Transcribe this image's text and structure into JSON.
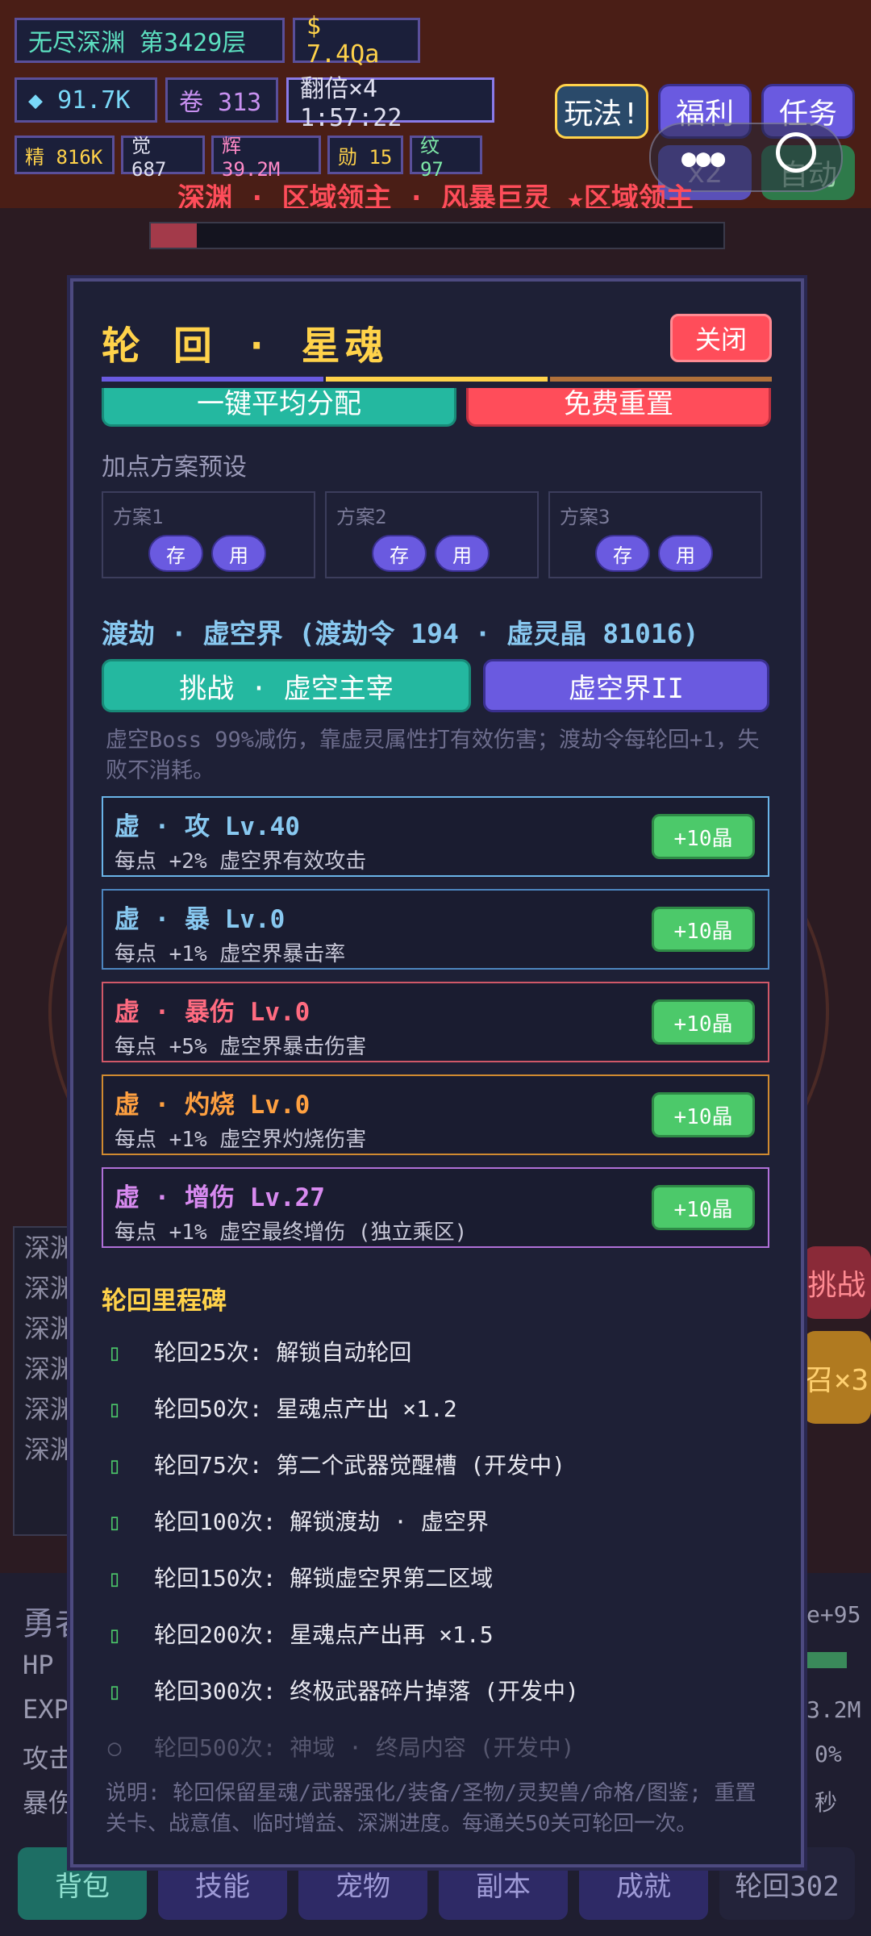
{
  "hud": {
    "realm": "无尽深渊 第3429层",
    "gold": "$ 7.4Qa",
    "diamond": "◆ 91.7K",
    "scroll": "卷 313",
    "multiplier": "翻倍×4 1:57:22",
    "stats": [
      "精 816K",
      "觉 687",
      "辉 39.2M",
      "勋 15",
      "纹 97"
    ],
    "buttons": {
      "play": "玩法!",
      "welfare": "福利",
      "tasks": "任务",
      "speed": "x2",
      "auto": "自动"
    },
    "boss_line": "深渊 · 区域领主 · 风暴巨灵 ★区域领主"
  },
  "behind": {
    "side_items": [
      "深渊",
      "深渊",
      "深渊",
      "深渊",
      "深渊",
      "深渊"
    ],
    "right_btn1": "挑战",
    "right_btn2": "召×3",
    "hero": "勇者",
    "hp": "HP",
    "exp": "EXP",
    "atk": "攻击",
    "crit": "暴伤",
    "right_val1": "e+95",
    "right_val2": "3.2M",
    "right_val3": "0%",
    "right_val4": "秒"
  },
  "tabs": [
    "背包",
    "技能",
    "宠物",
    "副本",
    "成就",
    "轮回302"
  ],
  "modal": {
    "title": "轮 回 · 星魂",
    "close": "关闭",
    "avg_btn": "一键平均分配",
    "reset_btn": "免费重置",
    "preset_label": "加点方案预设",
    "presets": [
      {
        "name": "方案1",
        "save": "存",
        "use": "用"
      },
      {
        "name": "方案2",
        "save": "存",
        "use": "用"
      },
      {
        "name": "方案3",
        "save": "存",
        "use": "用"
      }
    ],
    "void_title": "渡劫 · 虚空界 (渡劫令 194 · 虚灵晶 81016)",
    "challenge_btn": "挑战 · 虚空主宰",
    "realm_btn": "虚空界II",
    "void_desc": "虚空Boss 99%减伤，靠虚灵属性打有效伤害；渡劫令每轮回+1，失败不消耗。",
    "stats": [
      {
        "name": "虚 · 攻  Lv.40",
        "desc": "每点 +2% 虚空界有效攻击",
        "btn": "+10晶",
        "color": "#88c8f0",
        "border": "#6ab4e8"
      },
      {
        "name": "虚 · 暴  Lv.0",
        "desc": "每点 +1% 虚空界暴击率",
        "btn": "+10晶",
        "color": "#88c8f0",
        "border": "#4d86c0"
      },
      {
        "name": "虚 · 暴伤  Lv.0",
        "desc": "每点 +5% 虚空界暴击伤害",
        "btn": "+10晶",
        "color": "#ff6b80",
        "border": "#d05868"
      },
      {
        "name": "虚 · 灼烧  Lv.0",
        "desc": "每点 +1% 虚空界灼烧伤害",
        "btn": "+10晶",
        "color": "#ffa040",
        "border": "#d08a30"
      },
      {
        "name": "虚 · 增伤  Lv.27",
        "desc": "每点 +1% 虚空最终增伤 (独立乘区)",
        "btn": "+10晶",
        "color": "#d88af0",
        "border": "#b070d8"
      }
    ],
    "milestone_title": "轮回里程碑",
    "milestones": [
      {
        "text": "轮回25次: 解锁自动轮回",
        "done": true
      },
      {
        "text": "轮回50次: 星魂点产出 ×1.2",
        "done": true
      },
      {
        "text": "轮回75次: 第二个武器觉醒槽 (开发中)",
        "done": true
      },
      {
        "text": "轮回100次: 解锁渡劫 · 虚空界",
        "done": true
      },
      {
        "text": "轮回150次: 解锁虚空界第二区域",
        "done": true
      },
      {
        "text": "轮回200次: 星魂点产出再 ×1.5",
        "done": true
      },
      {
        "text": "轮回300次: 终极武器碎片掉落 (开发中)",
        "done": true
      },
      {
        "text": "轮回500次: 神域 · 终局内容 (开发中)",
        "done": false
      }
    ],
    "footer": "说明: 轮回保留星魂/武器强化/装备/圣物/灵契兽/命格/图鉴; 重置关卡、战意值、临时增益、深渊进度。每通关50关可轮回一次。"
  }
}
